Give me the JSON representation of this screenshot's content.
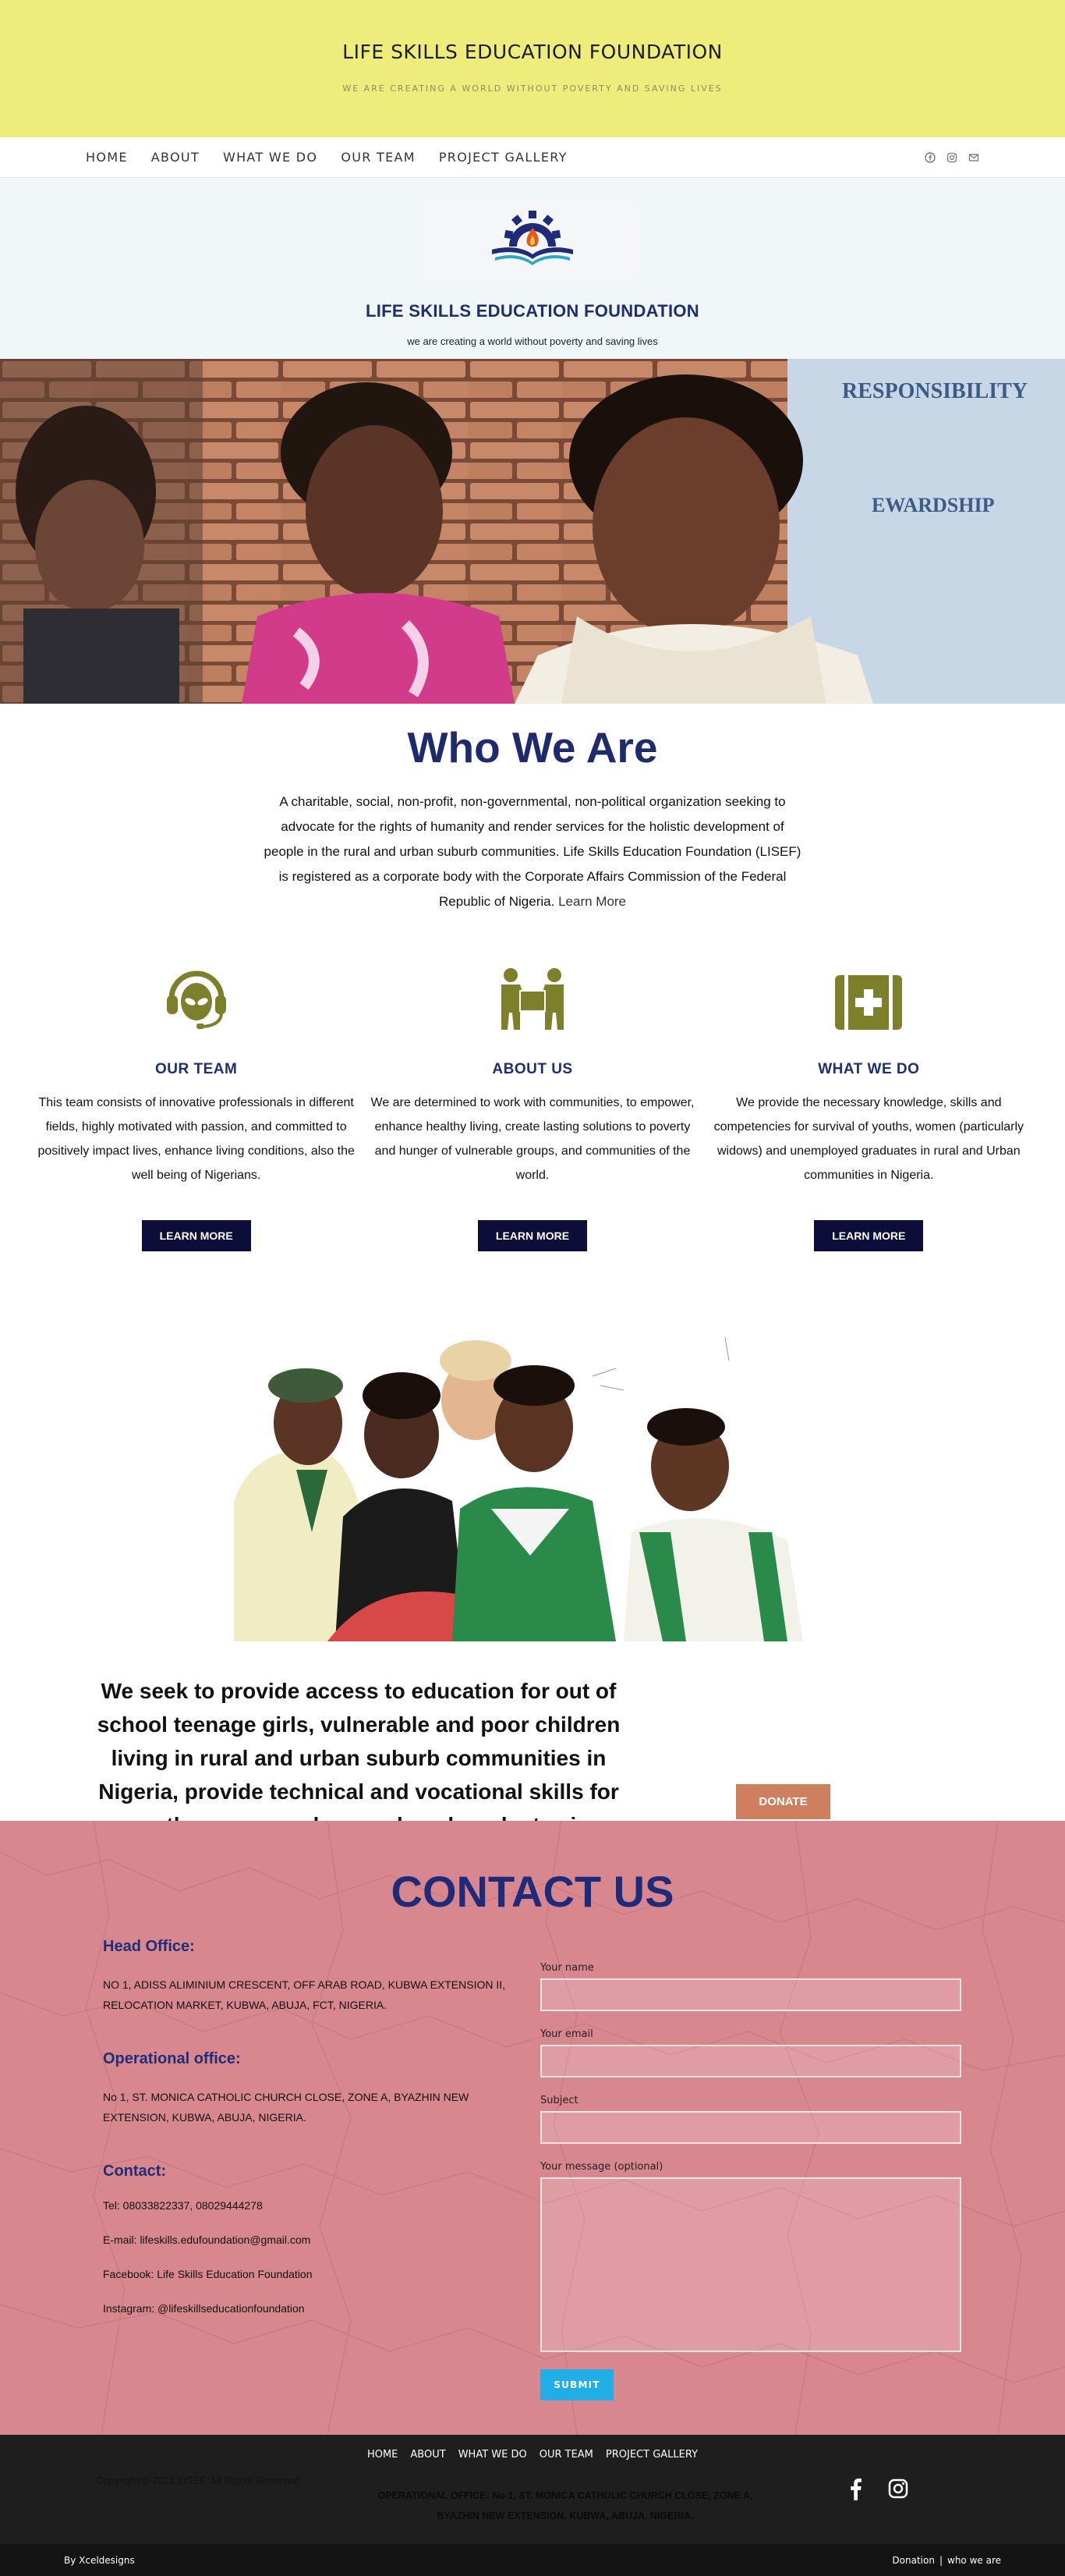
{
  "header": {
    "title": "LIFE SKILLS EDUCATION FOUNDATION",
    "tagline": "WE ARE CREATING A WORLD WITHOUT POVERTY AND SAVING LIVES"
  },
  "nav": {
    "items": [
      {
        "label": "HOME"
      },
      {
        "label": "ABOUT"
      },
      {
        "label": "WHAT WE DO"
      },
      {
        "label": "OUR TEAM"
      },
      {
        "label": "PROJECT GALLERY"
      }
    ],
    "social_icons": [
      "facebook-icon",
      "instagram-icon",
      "email-icon"
    ]
  },
  "brand": {
    "name": "LIFE SKILLS EDUCATION FOUNDATION",
    "tagline": "we are creating a world without poverty and saving lives"
  },
  "hero": {
    "sign_text_1": "RESPONSIBILITY",
    "sign_text_2": "EWARDSHIP"
  },
  "who": {
    "title": "Who We Are",
    "text": "A charitable, social, non-profit, non-governmental, non-political organization seeking to advocate for the rights of humanity and render services for the holistic development of people in the rural and urban suburb communities. Life Skills Education Foundation (LISEF) is registered as a corporate body with the Corporate Affairs Commission of the Federal Republic of Nigeria.",
    "link": "Learn More"
  },
  "features": [
    {
      "icon": "headset-support-icon",
      "title": "OUR TEAM",
      "text": "This team consists of innovative professionals in different fields, highly motivated with passion, and committed to positively impact lives, enhance living conditions, also the well being of Nigerians.",
      "button": "LEARN MORE"
    },
    {
      "icon": "people-carrying-box-icon",
      "title": "ABOUT US",
      "text": "We are determined to work with communities, to empower, enhance healthy living, create lasting solutions to poverty and hunger of vulnerable groups, and communities of the world.",
      "button": "LEARN MORE"
    },
    {
      "icon": "first-aid-kit-icon",
      "title": "WHAT WE DO",
      "text": "We provide the necessary knowledge, skills and competencies for survival of youths, women (particularly widows) and unemployed graduates in rural and Urban communities in Nigeria.",
      "button": "LEARN MORE"
    }
  ],
  "mission": {
    "text": "We seek to provide access to education for out of school teenage girls, vulnerable and poor children living in rural and urban suburb communities in Nigeria, provide technical and vocational skills for youth, women and unemployed graduates in Nigeria,..",
    "donate": "DONATE"
  },
  "contact": {
    "title": "CONTACT US",
    "head_office_label": "Head Office:",
    "head_office": "NO 1, ADISS ALIMINIUM CRESCENT, OFF ARAB ROAD, KUBWA EXTENSION II, RELOCATION MARKET, KUBWA, ABUJA, FCT, NIGERIA.",
    "operational_label": "Operational office:",
    "operational": "No 1, ST. MONICA CATHOLIC CHURCH CLOSE, ZONE A, BYAZHIN NEW EXTENSION, KUBWA, ABUJA, NIGERIA.",
    "contact_label": "Contact:",
    "tel": "Tel: 08033822337, 08029444278",
    "email": "E-mail: lifeskills.edufoundation@gmail.com",
    "facebook": "Facebook: Life Skills Education Foundation",
    "instagram": "Instagram: @lifeskillseducationfoundation",
    "form": {
      "name_label": "Your name",
      "email_label": "Your email",
      "subject_label": "Subject",
      "message_label": "Your message (optional)",
      "submit": "SUBMIT"
    }
  },
  "footer": {
    "nav": [
      {
        "label": "HOME"
      },
      {
        "label": "ABOUT"
      },
      {
        "label": "WHAT WE DO"
      },
      {
        "label": "OUR TEAM"
      },
      {
        "label": "PROJECT GALLERY"
      }
    ],
    "copyright": "Copyright © 2021 LISEF.  All Rights Reserved",
    "office_line_1": "OPERATIONAL OFFICE:  No 1, ST. MONICA CATHOLIC CHURCH CLOSE, ZONE A,",
    "office_line_2": "BYAZHIN NEW EXTENSION, KUBWA, ABUJA, NIGERIA.",
    "social_icons": [
      "facebook-icon",
      "instagram-icon"
    ],
    "credit": "By Xceldesigns",
    "link_donation": "Donation",
    "separator": "|",
    "link_who": "who we are"
  },
  "colors": {
    "header_bg": "#eeed7c",
    "navy": "#1f2a6e",
    "olive_icon": "#7d7f2a",
    "contact_bg": "#d8878f",
    "donate": "#cd7f5f",
    "submit": "#1faee6"
  }
}
